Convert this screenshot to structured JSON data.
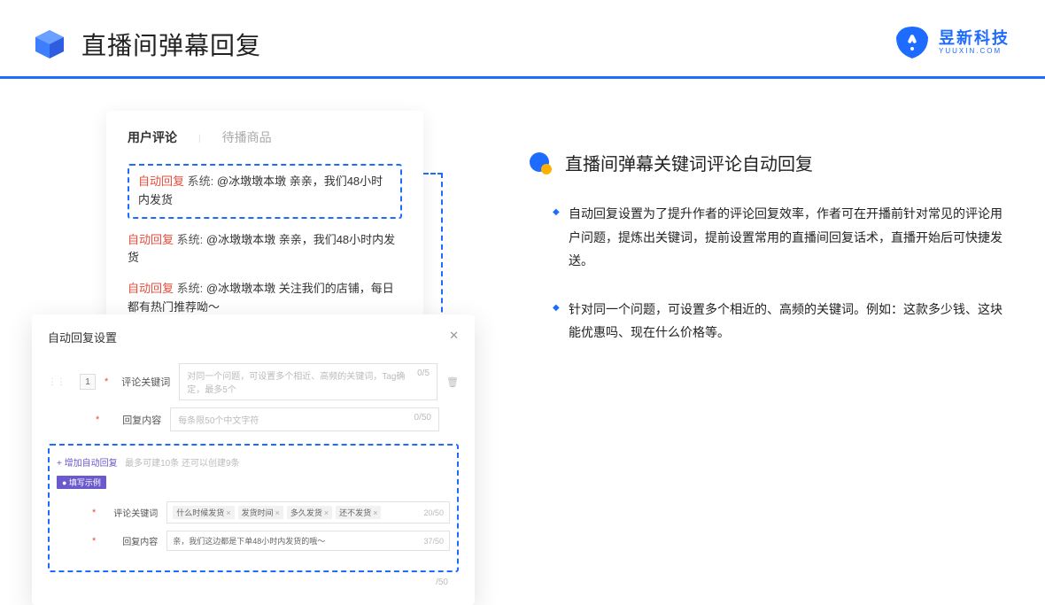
{
  "header": {
    "title": "直播间弹幕回复",
    "brand_name": "昱新科技",
    "brand_sub": "YUUXIN.COM"
  },
  "comments": {
    "tab_active": "用户评论",
    "tab_inactive": "待播商品",
    "auto_tag": "自动回复",
    "sys_label": "系统:",
    "row1": "@冰墩墩本墩 亲亲，我们48小时内发货",
    "row2": "@冰墩墩本墩 亲亲，我们48小时内发货",
    "row3": "@冰墩墩本墩 关注我们的店铺，每日都有热门推荐呦～"
  },
  "settings": {
    "title": "自动回复设置",
    "idx": "1",
    "kw_label": "评论关键词",
    "kw_placeholder": "对同一个问题，可设置多个相近、高频的关键词，Tag确定，最多5个",
    "kw_count": "0/5",
    "content_label": "回复内容",
    "content_placeholder": "每条限50个中文字符",
    "content_count": "0/50",
    "add_link": "+ 增加自动回复",
    "add_hint": "最多可建10条 还可以创建9条",
    "ex_tag": "● 填写示例",
    "ex_kw_label": "评论关键词",
    "ex_token1": "什么时候发货",
    "ex_token2": "发货时间",
    "ex_token3": "多久发货",
    "ex_token4": "还不发货",
    "ex_kw_count": "20/50",
    "ex_content_label": "回复内容",
    "ex_content_value": "亲，我们这边都是下单48小时内发货的哦～",
    "ex_content_count": "37/50",
    "outer_count": "/50"
  },
  "right": {
    "subtitle": "直播间弹幕关键词评论自动回复",
    "bullet1": "自动回复设置为了提升作者的评论回复效率，作者可在开播前针对常见的评论用户问题，提炼出关键词，提前设置常用的直播间回复话术，直播开始后可快捷发送。",
    "bullet2": "针对同一个问题，可设置多个相近的、高频的关键词。例如：这款多少钱、这块能优惠吗、现在什么价格等。"
  }
}
